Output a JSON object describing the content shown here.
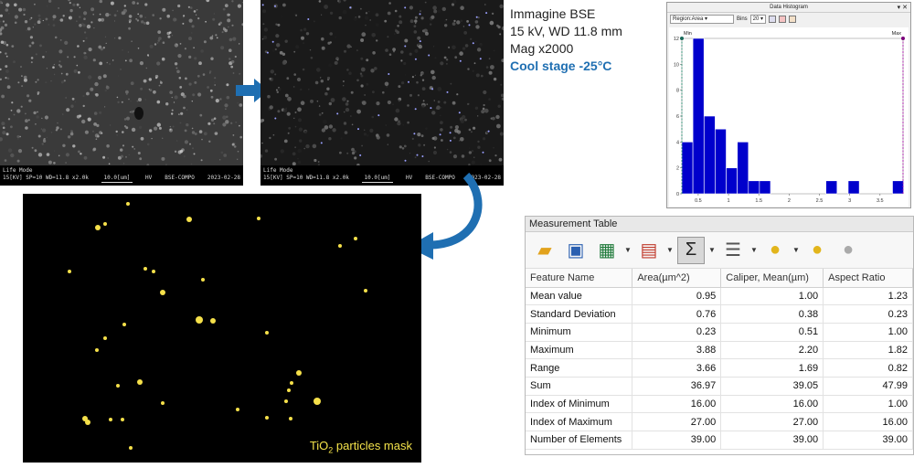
{
  "sem_left": {
    "mode": "Life Mode",
    "params": "15[KV]  SP=10  WD=11.8  x2.0k",
    "scale": "10.0[um]",
    "hv": "HV",
    "detector": "BSE-COMPO",
    "date": "2023-02-28"
  },
  "sem_right": {
    "mode": "Life Mode",
    "params": "15[KV]  SP=10  WD=11.8  x2.0k",
    "scale": "10.0[um]",
    "hv": "HV",
    "detector": "BSE-COMPO",
    "date": "2023-02-28"
  },
  "info": {
    "line1": "Immagine BSE",
    "line2": "15 kV, WD 11.8 mm",
    "line3": "Mag x2000",
    "line4": "Cool stage -25°C"
  },
  "mask": {
    "label_main": "TiO",
    "label_sub": "2",
    "label_rest": " particles mask"
  },
  "histogram": {
    "title": "Data Histogram",
    "region_select": "Region:Area",
    "bins_label": "Bins",
    "bins_value": "20",
    "min_label": "Min",
    "max_label": "Max",
    "bar_color": "#0000cc",
    "chart_data": {
      "type": "bar",
      "bin_start": 0.23,
      "bin_width": 0.183,
      "values": [
        4,
        12,
        6,
        5,
        2,
        4,
        1,
        1,
        0,
        0,
        0,
        0,
        0,
        1,
        0,
        1,
        0,
        0,
        0,
        1
      ],
      "xticks": [
        0.5,
        1,
        1.5,
        2,
        2.5,
        3,
        3.5
      ],
      "xlim": [
        0.23,
        3.88
      ],
      "yticks": [
        0,
        2,
        4,
        6,
        8,
        10,
        12
      ],
      "ylim": [
        0,
        12
      ]
    }
  },
  "table": {
    "title": "Measurement Table",
    "headers": [
      "Feature Name",
      "Area(µm^2)",
      "Caliper, Mean(µm)",
      "Aspect Ratio"
    ],
    "rows": [
      [
        "Mean value",
        "0.95",
        "1.00",
        "1.23"
      ],
      [
        "Standard Deviation",
        "0.76",
        "0.38",
        "0.23"
      ],
      [
        "Minimum",
        "0.23",
        "0.51",
        "1.00"
      ],
      [
        "Maximum",
        "3.88",
        "2.20",
        "1.82"
      ],
      [
        "Range",
        "3.66",
        "1.69",
        "0.82"
      ],
      [
        "Sum",
        "36.97",
        "39.05",
        "47.99"
      ],
      [
        "Index of Minimum",
        "16.00",
        "16.00",
        "1.00"
      ],
      [
        "Index of Maximum",
        "27.00",
        "27.00",
        "16.00"
      ],
      [
        "Number of Elements",
        "39.00",
        "39.00",
        "39.00"
      ]
    ]
  }
}
